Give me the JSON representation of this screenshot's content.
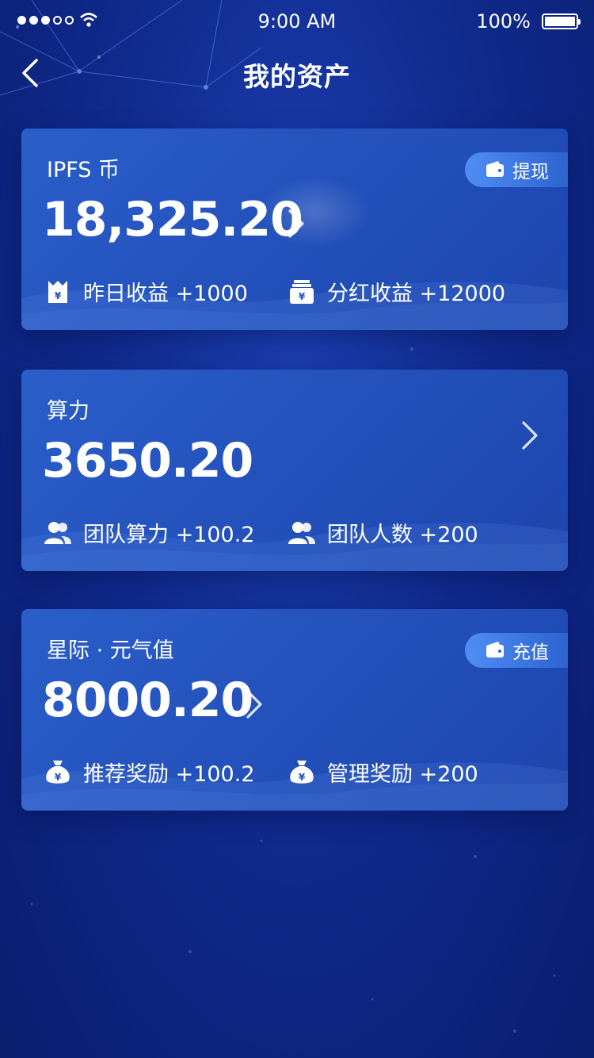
{
  "status_bar": {
    "time": "9:00 AM",
    "battery": "100%"
  },
  "nav": {
    "title": "我的资产"
  },
  "cards": [
    {
      "label": "IPFS 币",
      "value": "18,325.20",
      "action": "提现",
      "stats": [
        {
          "icon": "gift-icon",
          "text": "昨日收益 +1000"
        },
        {
          "icon": "money-stack-icon",
          "text": "分红收益 +12000"
        }
      ]
    },
    {
      "label": "算力",
      "value": "3650.20",
      "stats": [
        {
          "icon": "team-icon",
          "text": "团队算力 +100.2"
        },
        {
          "icon": "team-icon",
          "text": "团队人数 +200"
        }
      ]
    },
    {
      "label": "星际 · 元气值",
      "value": "8000.20",
      "action": "充值",
      "stats": [
        {
          "icon": "money-bag-icon",
          "text": "推荐奖励 +100.2"
        },
        {
          "icon": "money-bag-icon",
          "text": "管理奖励 +200"
        }
      ]
    }
  ]
}
